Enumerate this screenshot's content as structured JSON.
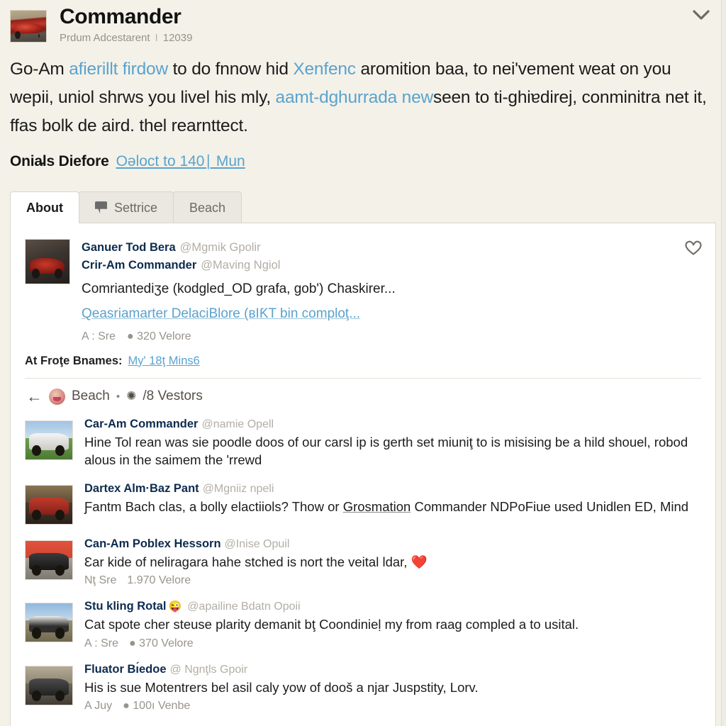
{
  "header": {
    "thumb_icon": "utv-photo",
    "title": "Commander",
    "subtitle": "Prdum Adcestarent",
    "sub_separator": "I",
    "count": "12039",
    "collapse_icon": "chevron-down-icon"
  },
  "intro": {
    "p1_a": "Go-Am ",
    "p1_link1": "afierillt firdow",
    "p1_b": " to do fnnow hid ",
    "p1_link2": "Xenfenc",
    "p1_c": " aromition baa, to neiʹvement weat on you wepii, uniol shrws you livel his mly, ",
    "p1_link3": "aamt-dghurrada new",
    "p1_d": "seen to ti-ghiɐdirej, conminitra net it, ffas bolk de aird. thel rearnttect."
  },
  "subline": {
    "label": "Onia̵ls Diefore",
    "link": "Oəloct to 140∣ Mun"
  },
  "tabs": [
    {
      "label": "About",
      "icon": null,
      "active": true
    },
    {
      "label": "Settrice",
      "icon": "flag-icon",
      "active": false
    },
    {
      "label": "Beach",
      "icon": null,
      "active": false
    }
  ],
  "card": {
    "like_icon": "heart-outline-icon",
    "featured": {
      "thumb_icon": "utv-photo",
      "line1_name": "Ganuer Tod Bera",
      "line1_handle": "@Mgmik Gpolir",
      "line2_name": "Crir-Am Commander",
      "line2_handle": "@Maving Ngiol",
      "text": "Comriantediʒe (kodgled_OD grafa, gob') Chaskirer...",
      "link": "Qeasriamarter DelaciBlore (ʙIƘT bin comploţ...",
      "meta_left": "A : Sre",
      "meta_icon": "pin-icon",
      "meta_right": "320 Velore"
    },
    "frote": {
      "label": "At Froţe Bnames:",
      "link": "Myʹ 18ţ Mins6"
    },
    "breadcrumb": {
      "back_icon": "back-arrow-icon",
      "avatar_icon": "avatar-icon",
      "label": "Beach",
      "dot": "•",
      "gear_icon": "gear-icon",
      "counter": "/8 Vestors"
    },
    "feed": [
      {
        "thumb_icon": "utv-photo-white-grass",
        "name": "Car-Am Commander",
        "emoji": null,
        "handle": "@namie Opell",
        "text": "Hine Tol rean was sie poodle doos of our carsl ip is gerth set miuniţ to is misising be a hild shouel, robod alous in the saimem the ʹrrewd",
        "text_underline": null,
        "heart": null,
        "meta_left": null,
        "meta_icon": null,
        "meta_right": null
      },
      {
        "thumb_icon": "utv-photo-red-barn",
        "name": "Dartex Alm·Baz Pant",
        "emoji": null,
        "handle": "@Mgniiz npeli",
        "text_pre": "Ƒantm Bach clas, a bolly elactiiols? Thow or ",
        "text_underline": "Grosmation",
        "text_post": " Commander NDPoFiue used Unidlen ED, Mind",
        "heart": null,
        "meta_left": null,
        "meta_icon": null,
        "meta_right": null
      },
      {
        "thumb_icon": "utv-photo-orange-wall",
        "name": "Can-Am Poblex Hessorn",
        "emoji": null,
        "handle": "@Inise Opuil",
        "text": "Ɛar kide of neliragara hahe stched is nort the veital ldar, ",
        "heart": "❤️",
        "meta_left": "Nţ Sre",
        "meta_icon": null,
        "meta_right": "1.970 Velore"
      },
      {
        "thumb_icon": "utv-photo-blue-sky",
        "name": "Stu kling Rotal",
        "emoji": "😜",
        "handle": "@apailine Bdatn Opoii",
        "text": "Cat spote cher steuse plarity demanit bţ Coondinieḷ my from raag compled a to usital.",
        "heart": null,
        "meta_left": "A : Sre",
        "meta_icon": "pin-icon",
        "meta_right": "370 Velore"
      },
      {
        "thumb_icon": "utv-photo-garage",
        "name": "Fluator Bı́edoe",
        "emoji": null,
        "handle": "@ Ngnţls Gpoir",
        "text": "His is sue Motentrers bel asil caly yow of dooš a njar Juspstity, Lorv.",
        "heart": null,
        "meta_left": "A Juy",
        "meta_icon": "pin-icon",
        "meta_right": "100ı Venbe"
      }
    ]
  },
  "colors": {
    "page_bg": "#f4f1e8",
    "card_bg": "#ffffff",
    "link": "#59a3cf",
    "name": "#0d2b4e",
    "muted": "#b3aea5",
    "heart_red": "#dd2e44"
  }
}
